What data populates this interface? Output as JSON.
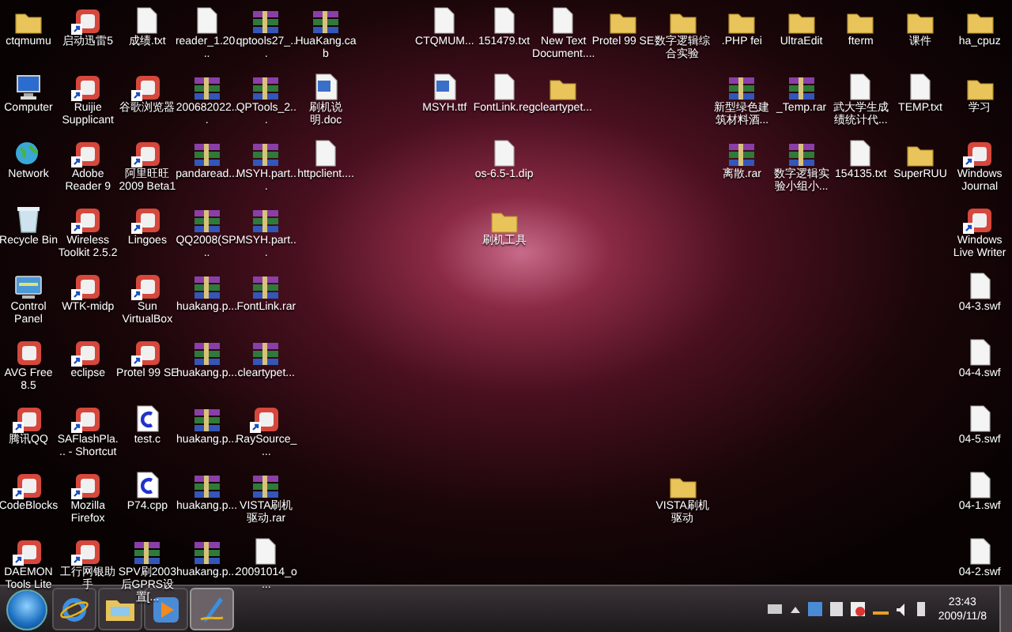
{
  "icons": [
    {
      "label": "ctqmumu",
      "kind": "folder",
      "shortcut": false
    },
    {
      "label": "Computer",
      "kind": "computer",
      "shortcut": false
    },
    {
      "label": "Network",
      "kind": "network",
      "shortcut": false
    },
    {
      "label": "Recycle Bin",
      "kind": "recycle-bin",
      "shortcut": false
    },
    {
      "label": "Control Panel",
      "kind": "control-panel",
      "shortcut": false
    },
    {
      "label": "AVG Free 8.5",
      "kind": "app",
      "shortcut": false
    },
    {
      "label": "腾讯QQ",
      "kind": "app",
      "shortcut": true
    },
    {
      "label": "CodeBlocks",
      "kind": "app",
      "shortcut": true
    },
    {
      "label": "DAEMON Tools Lite",
      "kind": "app",
      "shortcut": true
    },
    {
      "label": "启动迅雷5",
      "kind": "app",
      "shortcut": true
    },
    {
      "label": "Ruijie Supplicant",
      "kind": "app",
      "shortcut": true
    },
    {
      "label": "Adobe Reader 9",
      "kind": "app",
      "shortcut": true
    },
    {
      "label": "Wireless Toolkit 2.5.2",
      "kind": "app",
      "shortcut": true
    },
    {
      "label": "WTK-midp",
      "kind": "app",
      "shortcut": true
    },
    {
      "label": "eclipse",
      "kind": "app",
      "shortcut": true
    },
    {
      "label": "SAFlashPla... - Shortcut",
      "kind": "app",
      "shortcut": true
    },
    {
      "label": "Mozilla Firefox",
      "kind": "app",
      "shortcut": true
    },
    {
      "label": "工行网银助手",
      "kind": "app",
      "shortcut": true
    },
    {
      "label": "成绩.txt",
      "kind": "file",
      "shortcut": false
    },
    {
      "label": "谷歌浏览器",
      "kind": "app",
      "shortcut": true
    },
    {
      "label": "阿里旺旺 2009 Beta1",
      "kind": "app",
      "shortcut": true
    },
    {
      "label": "Lingoes",
      "kind": "app",
      "shortcut": true
    },
    {
      "label": "Sun VirtualBox",
      "kind": "app",
      "shortcut": true
    },
    {
      "label": "Protel 99 SE",
      "kind": "app",
      "shortcut": true
    },
    {
      "label": "test.c",
      "kind": "code",
      "shortcut": false
    },
    {
      "label": "P74.cpp",
      "kind": "code",
      "shortcut": false
    },
    {
      "label": "SPV刷2003后GPRS设置[...",
      "kind": "archive",
      "shortcut": false
    },
    {
      "label": "reader_1.20...",
      "kind": "file",
      "shortcut": false
    },
    {
      "label": "200682022...",
      "kind": "archive",
      "shortcut": false
    },
    {
      "label": "pandaread...",
      "kind": "archive",
      "shortcut": false
    },
    {
      "label": "QQ2008(SP...",
      "kind": "archive",
      "shortcut": false
    },
    {
      "label": "huakang.p...",
      "kind": "archive",
      "shortcut": false
    },
    {
      "label": "huakang.p...",
      "kind": "archive",
      "shortcut": false
    },
    {
      "label": "huakang.p...",
      "kind": "archive",
      "shortcut": false
    },
    {
      "label": "huakang.p...",
      "kind": "archive",
      "shortcut": false
    },
    {
      "label": "huakang.p...",
      "kind": "archive",
      "shortcut": false
    },
    {
      "label": "qptools27_...",
      "kind": "archive",
      "shortcut": false
    },
    {
      "label": "QPTools_2...",
      "kind": "archive",
      "shortcut": false
    },
    {
      "label": "MSYH.part...",
      "kind": "archive",
      "shortcut": false
    },
    {
      "label": "MSYH.part...",
      "kind": "archive",
      "shortcut": false
    },
    {
      "label": "FontLink.rar",
      "kind": "archive",
      "shortcut": false
    },
    {
      "label": "cleartypet...",
      "kind": "archive",
      "shortcut": false
    },
    {
      "label": "RaySource_...",
      "kind": "app",
      "shortcut": true
    },
    {
      "label": "VISTA刷机驱动.rar",
      "kind": "archive",
      "shortcut": false
    },
    {
      "label": "20091014_o...",
      "kind": "file",
      "shortcut": false
    },
    {
      "label": "HuaKang.cab",
      "kind": "archive",
      "shortcut": false
    },
    {
      "label": "刷机说明.doc",
      "kind": "document",
      "shortcut": false
    },
    {
      "label": "httpclient....",
      "kind": "file",
      "shortcut": false
    },
    {
      "label": "CTQMUM...",
      "kind": "file",
      "shortcut": false
    },
    {
      "label": "MSYH.ttf",
      "kind": "document",
      "shortcut": false
    },
    {
      "label": "151479.txt",
      "kind": "file",
      "shortcut": false
    },
    {
      "label": "FontLink.reg",
      "kind": "file",
      "shortcut": false
    },
    {
      "label": "os-6.5-1.dip",
      "kind": "file",
      "shortcut": false
    },
    {
      "label": "刷机工具",
      "kind": "folder",
      "shortcut": false
    },
    {
      "label": "New Text Document....",
      "kind": "file",
      "shortcut": false
    },
    {
      "label": "cleartypet...",
      "kind": "folder",
      "shortcut": false
    },
    {
      "label": "Protel 99 SE",
      "kind": "folder",
      "shortcut": false
    },
    {
      "label": "数字逻辑综合实验",
      "kind": "folder",
      "shortcut": false
    },
    {
      "label": "VISTA刷机驱动",
      "kind": "folder",
      "shortcut": false
    },
    {
      "label": ".PHP fei",
      "kind": "folder",
      "shortcut": false
    },
    {
      "label": "新型绿色建筑材料酒...",
      "kind": "archive",
      "shortcut": false
    },
    {
      "label": "离散.rar",
      "kind": "archive",
      "shortcut": false
    },
    {
      "label": "UltraEdit",
      "kind": "folder",
      "shortcut": false
    },
    {
      "label": "_Temp.rar",
      "kind": "archive",
      "shortcut": false
    },
    {
      "label": "数字逻辑实验小组小...",
      "kind": "archive",
      "shortcut": false
    },
    {
      "label": "fterm",
      "kind": "folder",
      "shortcut": false
    },
    {
      "label": "武大学生成绩统计代...",
      "kind": "file",
      "shortcut": false
    },
    {
      "label": "154135.txt",
      "kind": "file",
      "shortcut": false
    },
    {
      "label": "课件",
      "kind": "folder",
      "shortcut": false
    },
    {
      "label": "TEMP.txt",
      "kind": "file",
      "shortcut": false
    },
    {
      "label": "SuperRUU",
      "kind": "folder",
      "shortcut": false
    },
    {
      "label": "ha_cpuz",
      "kind": "folder",
      "shortcut": false
    },
    {
      "label": "学习",
      "kind": "folder",
      "shortcut": false
    },
    {
      "label": "Windows Journal",
      "kind": "app",
      "shortcut": true
    },
    {
      "label": "Windows Live Writer",
      "kind": "app",
      "shortcut": true
    },
    {
      "label": "04-3.swf",
      "kind": "file",
      "shortcut": false
    },
    {
      "label": "04-4.swf",
      "kind": "file",
      "shortcut": false
    },
    {
      "label": "04-5.swf",
      "kind": "file",
      "shortcut": false
    },
    {
      "label": "04-1.swf",
      "kind": "file",
      "shortcut": false
    },
    {
      "label": "04-2.swf",
      "kind": "file",
      "shortcut": false
    }
  ],
  "taskbar": {
    "pinned": [
      {
        "kind": "browser",
        "selected": false
      },
      {
        "kind": "explorer",
        "selected": false
      },
      {
        "kind": "media",
        "selected": false
      },
      {
        "kind": "writer",
        "selected": true
      }
    ],
    "clock": {
      "time": "23:43",
      "date": "2009/11/8"
    }
  }
}
